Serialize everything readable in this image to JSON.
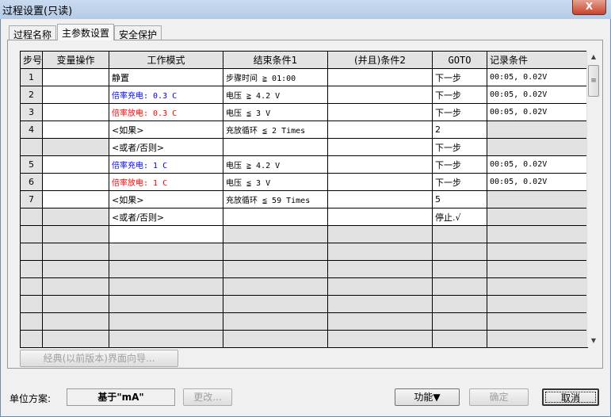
{
  "window": {
    "title": "过程设置(只读)",
    "close_label": "X"
  },
  "tabs": [
    {
      "label": "过程名称"
    },
    {
      "label": "主参数设置"
    },
    {
      "label": "安全保护"
    }
  ],
  "table": {
    "headers": [
      "步号",
      "变量操作",
      "工作模式",
      "结束条件1",
      "(并且)条件2",
      "GOTO",
      "记录条件"
    ],
    "rows": [
      {
        "step": "1",
        "var": "",
        "mode": "静置",
        "mode_color": "",
        "end1": "步骤时间 ≧ 01:00",
        "end2": "",
        "goto": "下一步",
        "record": "00:05, 0.02V",
        "kind": "normal"
      },
      {
        "step": "2",
        "var": "",
        "mode": "倍率充电: 0.3 C",
        "mode_color": "#0000ff",
        "end1": "电压 ≧ 4.2 V",
        "end2": "",
        "goto": "下一步",
        "record": "00:05, 0.02V",
        "kind": "normal"
      },
      {
        "step": "3",
        "var": "",
        "mode": "倍率放电: 0.3 C",
        "mode_color": "#ff0000",
        "end1": "电压 ≦ 3 V",
        "end2": "",
        "goto": "下一步",
        "record": "00:05, 0.02V",
        "kind": "normal"
      },
      {
        "step": "4",
        "var": "",
        "mode": "<如果>",
        "mode_color": "",
        "end1": "充放循环 ≦ 2 Times",
        "end2": "",
        "goto": "2",
        "record": "",
        "kind": "if"
      },
      {
        "step": "",
        "var": "",
        "mode": "<或者/否则>",
        "mode_color": "",
        "end1": "",
        "end2": "",
        "goto": "下一步",
        "record": "",
        "kind": "else"
      },
      {
        "step": "5",
        "var": "",
        "mode": "倍率充电: 1 C",
        "mode_color": "#0000ff",
        "end1": "电压 ≧ 4.2 V",
        "end2": "",
        "goto": "下一步",
        "record": "00:05, 0.02V",
        "kind": "normal"
      },
      {
        "step": "6",
        "var": "",
        "mode": "倍率放电: 1 C",
        "mode_color": "#ff0000",
        "end1": "电压 ≦ 3 V",
        "end2": "",
        "goto": "下一步",
        "record": "00:05, 0.02V",
        "kind": "normal"
      },
      {
        "step": "7",
        "var": "",
        "mode": "<如果>",
        "mode_color": "",
        "end1": "充放循环 ≦ 59 Times",
        "end2": "",
        "goto": "5",
        "record": "",
        "kind": "if"
      },
      {
        "step": "",
        "var": "",
        "mode": "<或者/否则>",
        "mode_color": "",
        "end1": "",
        "end2": "",
        "goto": "停止.√",
        "record": "",
        "kind": "else"
      },
      {
        "step": "",
        "var": "",
        "mode": "",
        "mode_color": "",
        "end1": "",
        "end2": "",
        "goto": "",
        "record": "",
        "kind": "new"
      }
    ],
    "empty_rows": 6
  },
  "buttons": {
    "classic_wizard": "经典(以前版本)界面向导...",
    "change": "更改...",
    "function": "功能▼",
    "ok": "确定",
    "cancel": "取消"
  },
  "unit": {
    "label": "单位方案:",
    "value": "基于\"mA\""
  }
}
